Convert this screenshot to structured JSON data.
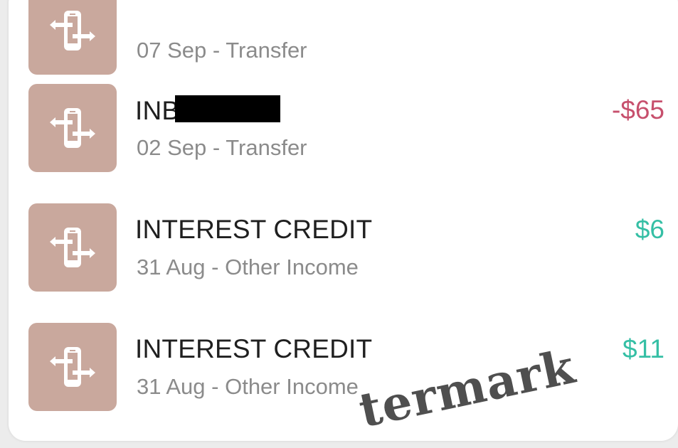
{
  "transactions": [
    {
      "name": "",
      "subtitle": "07 Sep - Transfer",
      "amount": "",
      "icon": "transfer-phone-icon"
    },
    {
      "name_prefix": "INB",
      "name_redacted": true,
      "subtitle": "02 Sep - Transfer",
      "amount": "-$65",
      "icon": "transfer-phone-icon"
    },
    {
      "name": "INTEREST CREDIT",
      "subtitle": "31 Aug - Other Income",
      "amount": "$6",
      "icon": "transfer-phone-icon"
    },
    {
      "name": "INTEREST CREDIT",
      "subtitle": "31 Aug - Other Income",
      "amount": "$11",
      "icon": "transfer-phone-icon"
    }
  ],
  "colors": {
    "icon_bg": "#c9a89d",
    "negative_amount": "#c7506d",
    "positive_amount": "#35bfa5",
    "title_text": "#1f1f1f",
    "subtitle_text": "#8b8b8b",
    "card_bg": "#ffffff"
  },
  "watermark": "termark"
}
